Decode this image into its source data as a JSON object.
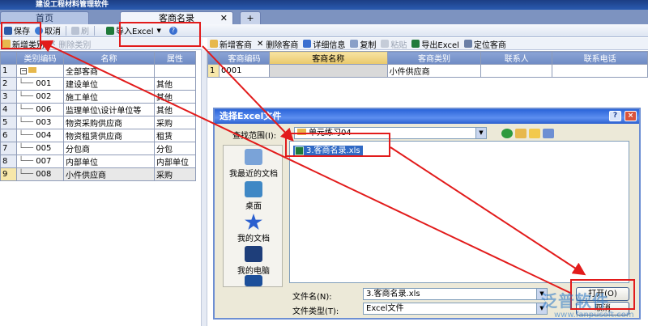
{
  "app": {
    "title": "建设工程材料管理软件"
  },
  "tabs": {
    "home": "首页",
    "active": "客商名录",
    "add": "+"
  },
  "toolbar": {
    "save": "保存",
    "cancel": "取消",
    "refresh": "刷",
    "import": "导入Excel",
    "help": "?"
  },
  "left_toolbar": {
    "add_category": "新增类别",
    "delete_category": "删除类别"
  },
  "right_toolbar": {
    "add": "新增客商",
    "delete": "删除客商",
    "detail": "详细信息",
    "copy": "复制",
    "paste": "粘贴",
    "export": "导出Excel",
    "locate": "定位客商"
  },
  "category_table": {
    "headers": [
      "类别编码",
      "名称",
      "属性"
    ],
    "rows": [
      {
        "n": "1",
        "code": "",
        "name": "全部客商",
        "attr": ""
      },
      {
        "n": "2",
        "code": "001",
        "name": "建设单位",
        "attr": "其他"
      },
      {
        "n": "3",
        "code": "002",
        "name": "施工单位",
        "attr": "其他"
      },
      {
        "n": "4",
        "code": "006",
        "name": "监理单位\\设计单位等",
        "attr": "其他"
      },
      {
        "n": "5",
        "code": "003",
        "name": "物资采购供应商",
        "attr": "采购"
      },
      {
        "n": "6",
        "code": "004",
        "name": "物资租赁供应商",
        "attr": "租赁"
      },
      {
        "n": "7",
        "code": "005",
        "name": "分包商",
        "attr": "分包"
      },
      {
        "n": "8",
        "code": "007",
        "name": "内部单位",
        "attr": "内部单位"
      },
      {
        "n": "9",
        "code": "008",
        "name": "小件供应商",
        "attr": "采购"
      }
    ]
  },
  "merchant_table": {
    "headers": [
      "客商编码",
      "客商名称",
      "客商类别",
      "联系人",
      "联系电话"
    ],
    "rows": [
      {
        "n": "1",
        "code": "0001",
        "name": "",
        "category": "小件供应商",
        "contact": "",
        "phone": ""
      }
    ]
  },
  "dialog": {
    "title": "选择Excel文件",
    "help_btn": "?",
    "close_btn": "×",
    "look_in_label": "查找范围(I):",
    "look_in_value": "单元练习04",
    "places": [
      "我最近的文档",
      "桌面",
      "我的文档",
      "我的电脑"
    ],
    "file": "3.客商名录.xls",
    "filename_label": "文件名(N):",
    "filename_value": "3.客商名录.xls",
    "filetype_label": "文件类型(T):",
    "filetype_value": "Excel文件",
    "open_btn": "打开(O)",
    "cancel_btn": "取消"
  },
  "watermark": {
    "brand": "泛普软件",
    "url": "www.fanpusoft.com"
  },
  "colors": {
    "accent": "#316ac5",
    "annotation": "#e21b1b",
    "header": "#7a94c9"
  }
}
